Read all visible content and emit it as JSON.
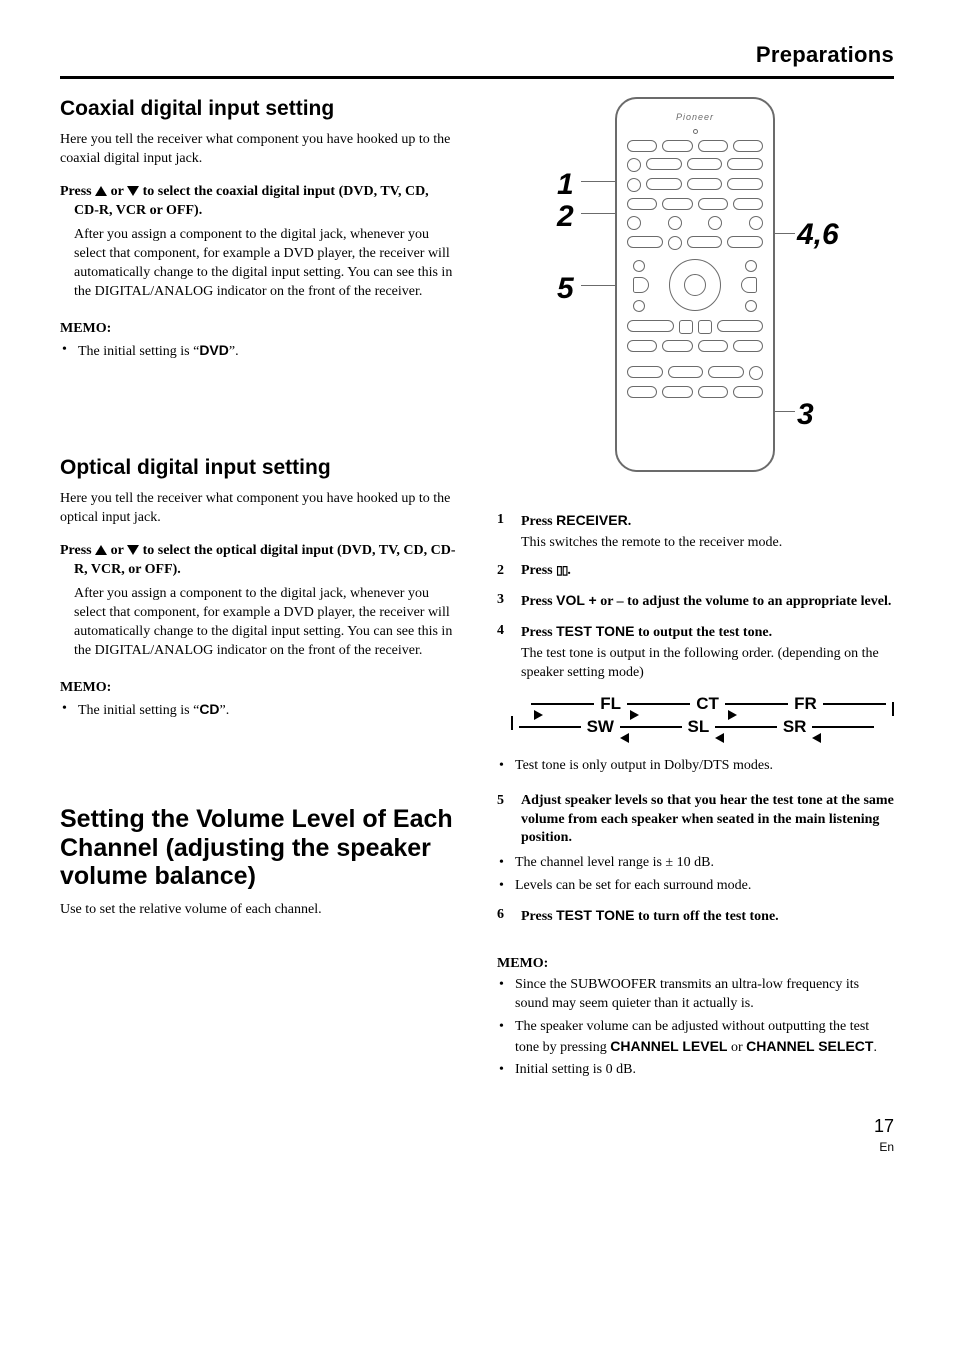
{
  "header": {
    "section": "Preparations"
  },
  "left": {
    "coax": {
      "heading": "Coaxial digital input setting",
      "intro": "Here you tell the receiver what component you have hooked up to the coaxial digital input jack.",
      "action_pre": "Press ",
      "action_mid": " or ",
      "action_post": " to select the coaxial digital input (DVD, TV, CD, CD-R, VCR or OFF).",
      "body": "After you assign a component to the digital jack, whenever you select that component, for example a DVD player, the receiver will automatically change to the digital input setting. You can see this in the DIGITAL/ANALOG indicator on the front of the receiver.",
      "memo_h": "MEMO:",
      "memo_pre": "The initial setting is “",
      "memo_val": "DVD",
      "memo_post": "”."
    },
    "opt": {
      "heading": "Optical digital input setting",
      "intro": "Here you tell the receiver what component you have hooked up to the optical input jack.",
      "action_pre": "Press ",
      "action_mid": " or ",
      "action_post": " to select the optical digital input  (DVD, TV, CD, CD-R, VCR, or OFF).",
      "body": "After you assign a component to the digital jack, whenever you select that component, for example a DVD player, the receiver will automatically change to the digital input setting. You can see this in the DIGITAL/ANALOG indicator on the front of the receiver.",
      "memo_h": "MEMO:",
      "memo_pre": "The initial setting is “",
      "memo_val": "CD",
      "memo_post": "”."
    },
    "vol": {
      "heading": "Setting the Volume Level of Each Channel (adjusting the speaker volume balance)",
      "intro": "Use to set the relative volume of each channel."
    }
  },
  "remote": {
    "brand": "Pioneer",
    "callouts": {
      "c1": "1",
      "c2": "2",
      "c5": "5",
      "c46": "4,6",
      "c3": "3"
    }
  },
  "right": {
    "s1": {
      "n": "1",
      "lead": "Press ",
      "kw": "RECEIVER",
      "tail": ".",
      "body": "This switches the remote to the receiver mode."
    },
    "s2": {
      "n": "2",
      "lead": "Press ",
      "kw": "",
      "tail": "."
    },
    "s3": {
      "n": "3",
      "lead": "Press ",
      "kw": "VOL +",
      "tail": " or – to adjust the volume to an appropriate level."
    },
    "s4": {
      "n": "4",
      "lead": "Press ",
      "kw": "TEST TONE",
      "tail": " to output the test tone.",
      "body": "The test tone is output in the following order. (depending on the speaker setting mode)"
    },
    "flow": {
      "fl": "FL",
      "ct": "CT",
      "fr": "FR",
      "sw": "SW",
      "sl": "SL",
      "sr": "SR"
    },
    "note1": "Test tone is only output in Dolby/DTS modes.",
    "s5": {
      "n": "5",
      "txt": "Adjust speaker levels so that you hear the test tone at the same volume from each speaker when seated in the main listening position."
    },
    "b1": "The channel level range is ± 10 dB.",
    "b2": "Levels can be set for each surround mode.",
    "s6": {
      "n": "6",
      "lead": "Press ",
      "kw": "TEST TONE",
      "tail": " to turn off the test tone."
    },
    "memo_h": "MEMO:",
    "m1": "Since the SUBWOOFER transmits an ultra-low frequency its sound may seem quieter than it actually is.",
    "m2a": "The speaker volume can be adjusted without outputting the test tone by pressing ",
    "m2b": "CHANNEL LEVEL",
    "m2c": " or ",
    "m2d": "CHANNEL SELECT",
    "m2e": ".",
    "m3": "Initial setting is 0 dB."
  },
  "footer": {
    "page": "17",
    "lang": "En"
  }
}
